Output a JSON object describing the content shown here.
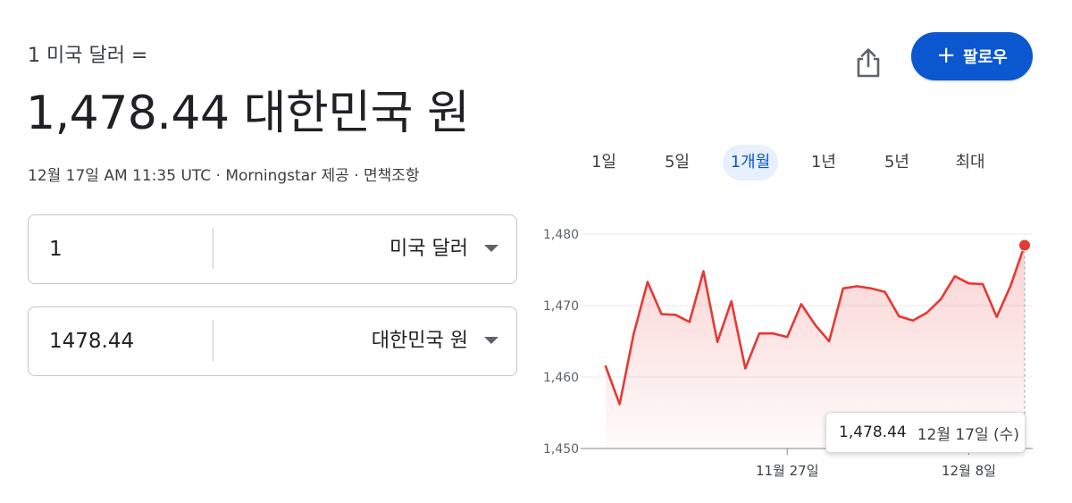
{
  "header": {
    "from_label": "1 미국 달러 =",
    "rate_value": "1,478.44 대한민국 원",
    "meta_text": "12월 17일 AM 11:35 UTC · Morningstar 제공 · 면책조항"
  },
  "actions": {
    "share_icon": "share-icon",
    "follow_label": "팔로우",
    "accent_color": "#0b57d0"
  },
  "converter": {
    "from_amount": "1",
    "from_currency": "미국 달러",
    "to_amount": "1478.44",
    "to_currency": "대한민국 원"
  },
  "ranges": {
    "items": [
      "1일",
      "5일",
      "1개월",
      "1년",
      "5년",
      "최대"
    ],
    "selected": "1개월"
  },
  "tooltip": {
    "value": "1,478.44",
    "date": "12월 17일 (수)"
  },
  "chart_data": {
    "type": "area",
    "title": "",
    "xlabel": "",
    "ylabel": "",
    "ylim": [
      1450,
      1480
    ],
    "yticks": [
      "1,480",
      "1,470",
      "1,460",
      "1,450"
    ],
    "ytick_values": [
      1480,
      1470,
      1460,
      1450
    ],
    "xticks": [
      "11월 27일",
      "12월 8일"
    ],
    "xtick_index": [
      13,
      26
    ],
    "line_color": "#e53935",
    "grid": true,
    "values": [
      1461.5,
      1456.2,
      1466.0,
      1473.3,
      1468.8,
      1468.7,
      1467.7,
      1474.8,
      1464.9,
      1470.6,
      1461.2,
      1466.1,
      1466.1,
      1465.6,
      1470.2,
      1467.3,
      1465.0,
      1472.4,
      1472.7,
      1472.4,
      1471.9,
      1468.5,
      1467.9,
      1469.0,
      1470.9,
      1474.1,
      1473.1,
      1473.0,
      1468.4,
      1472.8,
      1478.44
    ]
  }
}
